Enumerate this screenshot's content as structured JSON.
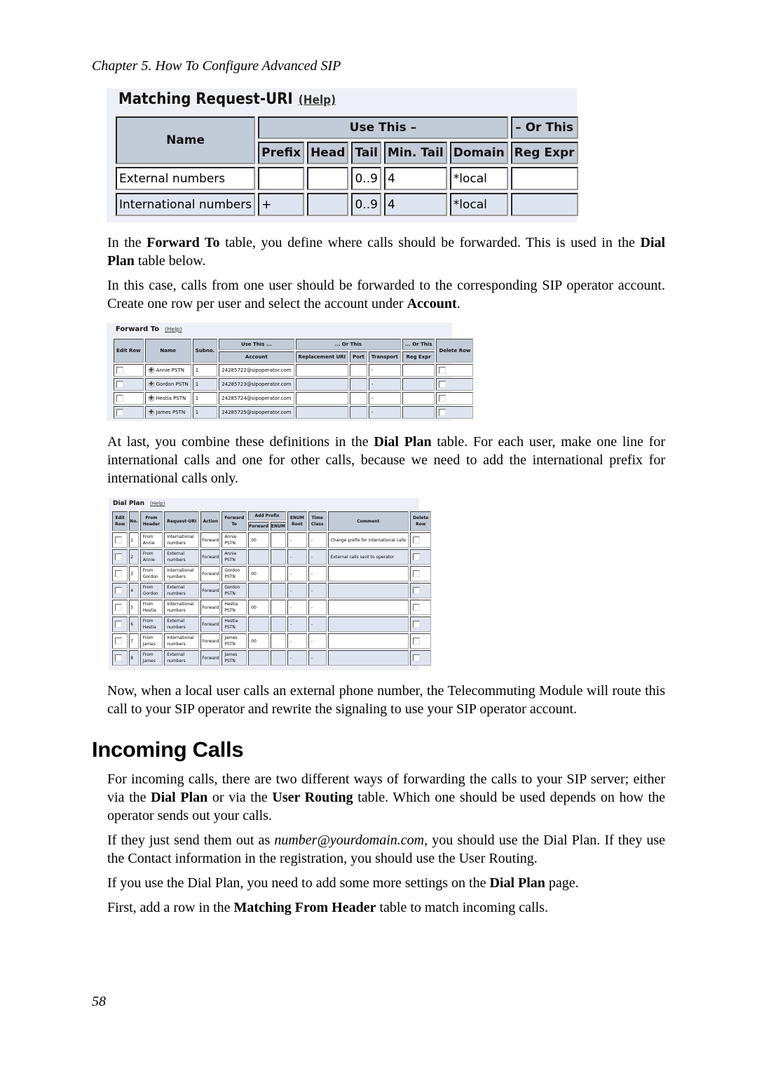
{
  "running_header": "Chapter 5. How To Configure Advanced SIP",
  "page_number": "58",
  "matching_request_uri": {
    "title": "Matching Request-URI",
    "help": "(Help)",
    "headers": {
      "name": "Name",
      "use_this": "Use This –",
      "or_this": "– Or This",
      "prefix": "Prefix",
      "head": "Head",
      "tail": "Tail",
      "min_tail": "Min. Tail",
      "domain": "Domain",
      "reg_expr": "Reg Expr"
    },
    "rows": [
      {
        "name": "External numbers",
        "prefix": "",
        "head": "",
        "tail": "0..9",
        "min_tail": "4",
        "domain": "*local",
        "reg_expr": ""
      },
      {
        "name": "International numbers",
        "prefix": "+",
        "head": "",
        "tail": "0..9",
        "min_tail": "4",
        "domain": "*local",
        "reg_expr": ""
      }
    ]
  },
  "paragraphs": {
    "p1": {
      "a": "In the ",
      "b1": "Forward To",
      "c": " table, you define where calls should be forwarded. This is used in the ",
      "b2": "Dial Plan",
      "d": " table below."
    },
    "p2": {
      "a": "In this case, calls from one user should be forwarded to the corresponding SIP operator account. Create one row per user and select the account under ",
      "b1": "Account",
      "c": "."
    },
    "p3": {
      "a": "At last, you combine these definitions in the ",
      "b1": "Dial Plan",
      "c": " table. For each user, make one line for international calls and one for other calls, because we need to add the international prefix for international calls only."
    },
    "p4": {
      "a": "Now, when a local user calls an external phone number, the Telecommuting Module will route this call to your SIP operator and rewrite the signaling to use your SIP operator account."
    },
    "p5": {
      "a": "For incoming calls, there are two different ways of forwarding the calls to your SIP server; either via the ",
      "b1": "Dial Plan",
      "c": " or via the ",
      "b2": "User Routing",
      "d": " table. Which one should be used depends on how the operator sends out your calls."
    },
    "p6": {
      "a": "If they just send them out as ",
      "i1": "number@yourdomain.com",
      "c": ", you should use the Dial Plan. If they use the Contact information in the registration, you should use the User Routing."
    },
    "p7": {
      "a": "If you use the Dial Plan, you need to add some more settings on the ",
      "b1": "Dial Plan",
      "c": " page."
    },
    "p8": {
      "a": "First, add a row in the ",
      "b1": "Matching From Header",
      "c": " table to match incoming calls."
    }
  },
  "section_heading": "Incoming Calls",
  "forward_to": {
    "title": "Forward To",
    "help": "(Help)",
    "headers": {
      "edit_row": "Edit Row",
      "name": "Name",
      "subno": "Subno.",
      "use_this": "Use This ...",
      "or_this": "... Or This",
      "or_this2": "... Or This",
      "delete_row": "Delete Row",
      "account": "Account",
      "replacement_uri": "Replacement URI",
      "port": "Port",
      "transport": "Transport",
      "reg_expr": "Reg Expr"
    },
    "rows": [
      {
        "name": "Annie PSTN",
        "subno": "1",
        "account": "24285722@sipoperator.com",
        "replacement_uri": "",
        "port": "",
        "transport": "-",
        "reg_expr": ""
      },
      {
        "name": "Gordon PSTN",
        "subno": "1",
        "account": "24285723@sipoperator.com",
        "replacement_uri": "",
        "port": "",
        "transport": "-",
        "reg_expr": ""
      },
      {
        "name": "Hestia PSTN",
        "subno": "1",
        "account": "24285724@sipoperator.com",
        "replacement_uri": "",
        "port": "",
        "transport": "-",
        "reg_expr": ""
      },
      {
        "name": "James PSTN",
        "subno": "1",
        "account": "24285725@sipoperator.com",
        "replacement_uri": "",
        "port": "",
        "transport": "-",
        "reg_expr": ""
      }
    ]
  },
  "dial_plan": {
    "title": "Dial Plan",
    "help": "(Help)",
    "headers": {
      "edit_row_1": "Edit",
      "edit_row_2": "Row",
      "no": "No.",
      "from_header_1": "From",
      "from_header_2": "Header",
      "request_uri": "Request-URI",
      "action": "Action",
      "forward_to_1": "Forward",
      "forward_to_2": "To",
      "add_prefix": "Add Prefix",
      "forward": "Forward",
      "enum": "ENUM",
      "enum_root_1": "ENUM",
      "enum_root_2": "Root",
      "time_class_1": "Time",
      "time_class_2": "Class",
      "comment": "Comment",
      "delete_row_1": "Delete",
      "delete_row_2": "Row"
    },
    "rows": [
      {
        "no": "1",
        "from1": "From",
        "from2": "Annie",
        "uri1": "International",
        "uri2": "numbers",
        "action": "Forward",
        "fwd1": "Annie",
        "fwd2": "PSTN",
        "prefix_forward": "00",
        "prefix_enum": "",
        "enum_root": "-",
        "time_class": "-",
        "comment": "Change prefix for international calls"
      },
      {
        "no": "2",
        "from1": "From",
        "from2": "Annie",
        "uri1": "External",
        "uri2": "numbers",
        "action": "Forward",
        "fwd1": "Annie",
        "fwd2": "PSTN",
        "prefix_forward": "",
        "prefix_enum": "",
        "enum_root": "-",
        "time_class": "-",
        "comment": "External calls sent to operator"
      },
      {
        "no": "3",
        "from1": "From",
        "from2": "Gordon",
        "uri1": "International",
        "uri2": "numbers",
        "action": "Forward",
        "fwd1": "Gordon",
        "fwd2": "PSTN",
        "prefix_forward": "00",
        "prefix_enum": "",
        "enum_root": "-",
        "time_class": "-",
        "comment": ""
      },
      {
        "no": "4",
        "from1": "From",
        "from2": "Gordon",
        "uri1": "External",
        "uri2": "numbers",
        "action": "Forward",
        "fwd1": "Gordon",
        "fwd2": "PSTN",
        "prefix_forward": "",
        "prefix_enum": "",
        "enum_root": "-",
        "time_class": "-",
        "comment": ""
      },
      {
        "no": "5",
        "from1": "From",
        "from2": "Hestia",
        "uri1": "International",
        "uri2": "numbers",
        "action": "Forward",
        "fwd1": "Hestia",
        "fwd2": "PSTN",
        "prefix_forward": "00",
        "prefix_enum": "",
        "enum_root": "-",
        "time_class": "-",
        "comment": ""
      },
      {
        "no": "6",
        "from1": "From",
        "from2": "Hestia",
        "uri1": "External",
        "uri2": "numbers",
        "action": "Forward",
        "fwd1": "Hestia",
        "fwd2": "PSTN",
        "prefix_forward": "",
        "prefix_enum": "",
        "enum_root": "-",
        "time_class": "-",
        "comment": ""
      },
      {
        "no": "7",
        "from1": "From",
        "from2": "James",
        "uri1": "International",
        "uri2": "numbers",
        "action": "Forward",
        "fwd1": "James",
        "fwd2": "PSTN",
        "prefix_forward": "00",
        "prefix_enum": "",
        "enum_root": "-",
        "time_class": "-",
        "comment": ""
      },
      {
        "no": "8",
        "from1": "From",
        "from2": "James",
        "uri1": "External",
        "uri2": "numbers",
        "action": "Forward",
        "fwd1": "James",
        "fwd2": "PSTN",
        "prefix_forward": "",
        "prefix_enum": "",
        "enum_root": "-",
        "time_class": "-",
        "comment": ""
      }
    ]
  }
}
